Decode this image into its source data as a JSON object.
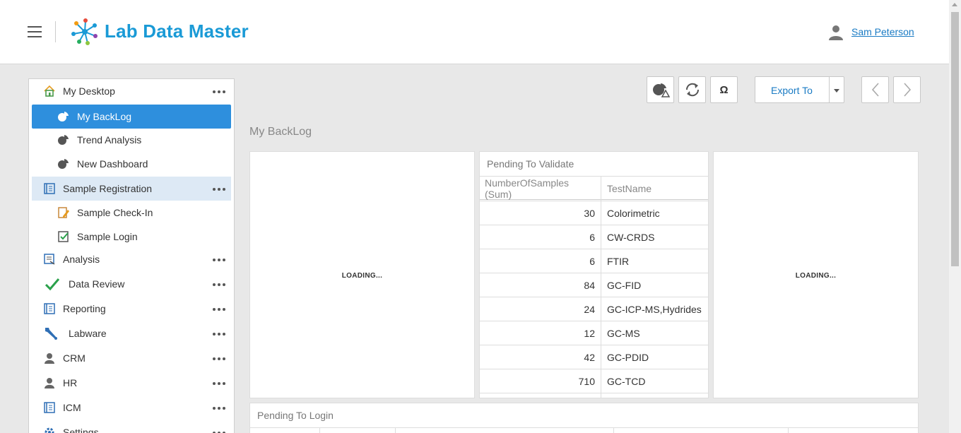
{
  "header": {
    "brand": "Lab Data Master",
    "user_name": "Sam Peterson"
  },
  "sidebar": {
    "items": [
      {
        "label": "My Desktop",
        "icon": "home-icon",
        "has_more": true
      },
      {
        "label": "My BackLog",
        "icon": "dashboard-icon",
        "selected": true
      },
      {
        "label": "Trend Analysis",
        "icon": "dashboard-icon"
      },
      {
        "label": "New Dashboard",
        "icon": "dashboard-icon"
      },
      {
        "label": "Sample Registration",
        "icon": "document-icon",
        "has_more": true
      },
      {
        "label": "Sample Check-In",
        "icon": "edit-document-icon"
      },
      {
        "label": "Sample Login",
        "icon": "checklist-icon"
      },
      {
        "label": "Analysis",
        "icon": "analysis-icon",
        "has_more": true
      },
      {
        "label": "Data Review",
        "icon": "checkmark-icon",
        "has_more": true
      },
      {
        "label": "Reporting",
        "icon": "document-icon",
        "has_more": true
      },
      {
        "label": "Labware",
        "icon": "wrench-icon",
        "has_more": true
      },
      {
        "label": "CRM",
        "icon": "person-icon",
        "has_more": true
      },
      {
        "label": "HR",
        "icon": "person-icon",
        "has_more": true
      },
      {
        "label": "ICM",
        "icon": "document-icon",
        "has_more": true
      },
      {
        "label": "Settings",
        "icon": "gear-icon",
        "has_more": true
      }
    ]
  },
  "toolbar": {
    "export_label": "Export To",
    "omega_label": "Ω"
  },
  "main": {
    "page_title": "My BackLog",
    "loading_text": "LOADING...",
    "pending_validate": {
      "title": "Pending To Validate",
      "columns": [
        "NumberOfSamples (Sum)",
        "TestName"
      ],
      "rows": [
        [
          "30",
          "Colorimetric"
        ],
        [
          "6",
          "CW-CRDS"
        ],
        [
          "6",
          "FTIR"
        ],
        [
          "84",
          "GC-FID"
        ],
        [
          "24",
          "GC-ICP-MS,Hydrides"
        ],
        [
          "12",
          "GC-MS"
        ],
        [
          "42",
          "GC-PDID"
        ],
        [
          "710",
          "GC-TCD"
        ]
      ]
    },
    "pending_login": {
      "title": "Pending To Login"
    }
  },
  "colors": {
    "accent": "#2e8fdd",
    "brand": "#1a9ad6",
    "link": "#1a7bc4"
  }
}
